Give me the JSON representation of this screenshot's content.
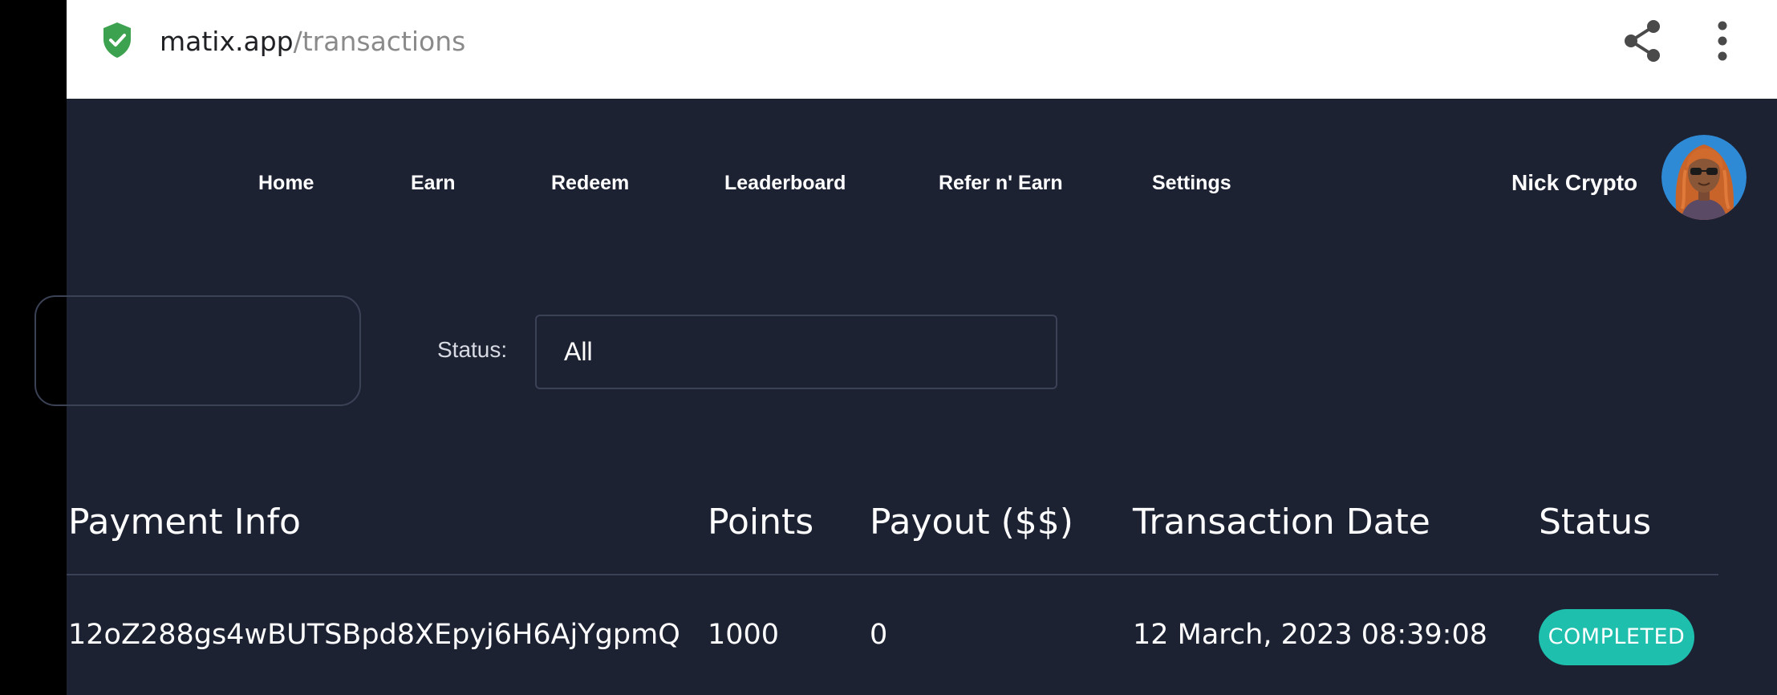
{
  "browser": {
    "url_domain": "matix.app",
    "url_path": "/transactions",
    "icons": [
      "shield-check-icon",
      "share-icon",
      "more-vert-icon"
    ],
    "shield_color": "#3da24f"
  },
  "nav": {
    "items": [
      {
        "label": "Home"
      },
      {
        "label": "Earn"
      },
      {
        "label": "Redeem"
      },
      {
        "label": "Leaderboard"
      },
      {
        "label": "Refer n' Earn"
      },
      {
        "label": "Settings"
      }
    ]
  },
  "user": {
    "name": "Nick Crypto",
    "avatar_icon": "user-avatar"
  },
  "filters": {
    "status_label": "Status:",
    "status_value": "All"
  },
  "table": {
    "headers": [
      "Payment Info",
      "Points",
      "Payout ($$)",
      "Transaction Date",
      "Status"
    ],
    "rows": [
      {
        "payment_info": "12oZ288gs4wBUTSBpd8XEpyj6H6AjYgpmQ",
        "points": "1000",
        "payout": "0",
        "date": "12 March, 2023 08:39:08",
        "status": "COMPLETED"
      }
    ]
  },
  "colors": {
    "background": "#1d2233",
    "status_completed": "#1fbfae",
    "border": "#3b4256"
  }
}
